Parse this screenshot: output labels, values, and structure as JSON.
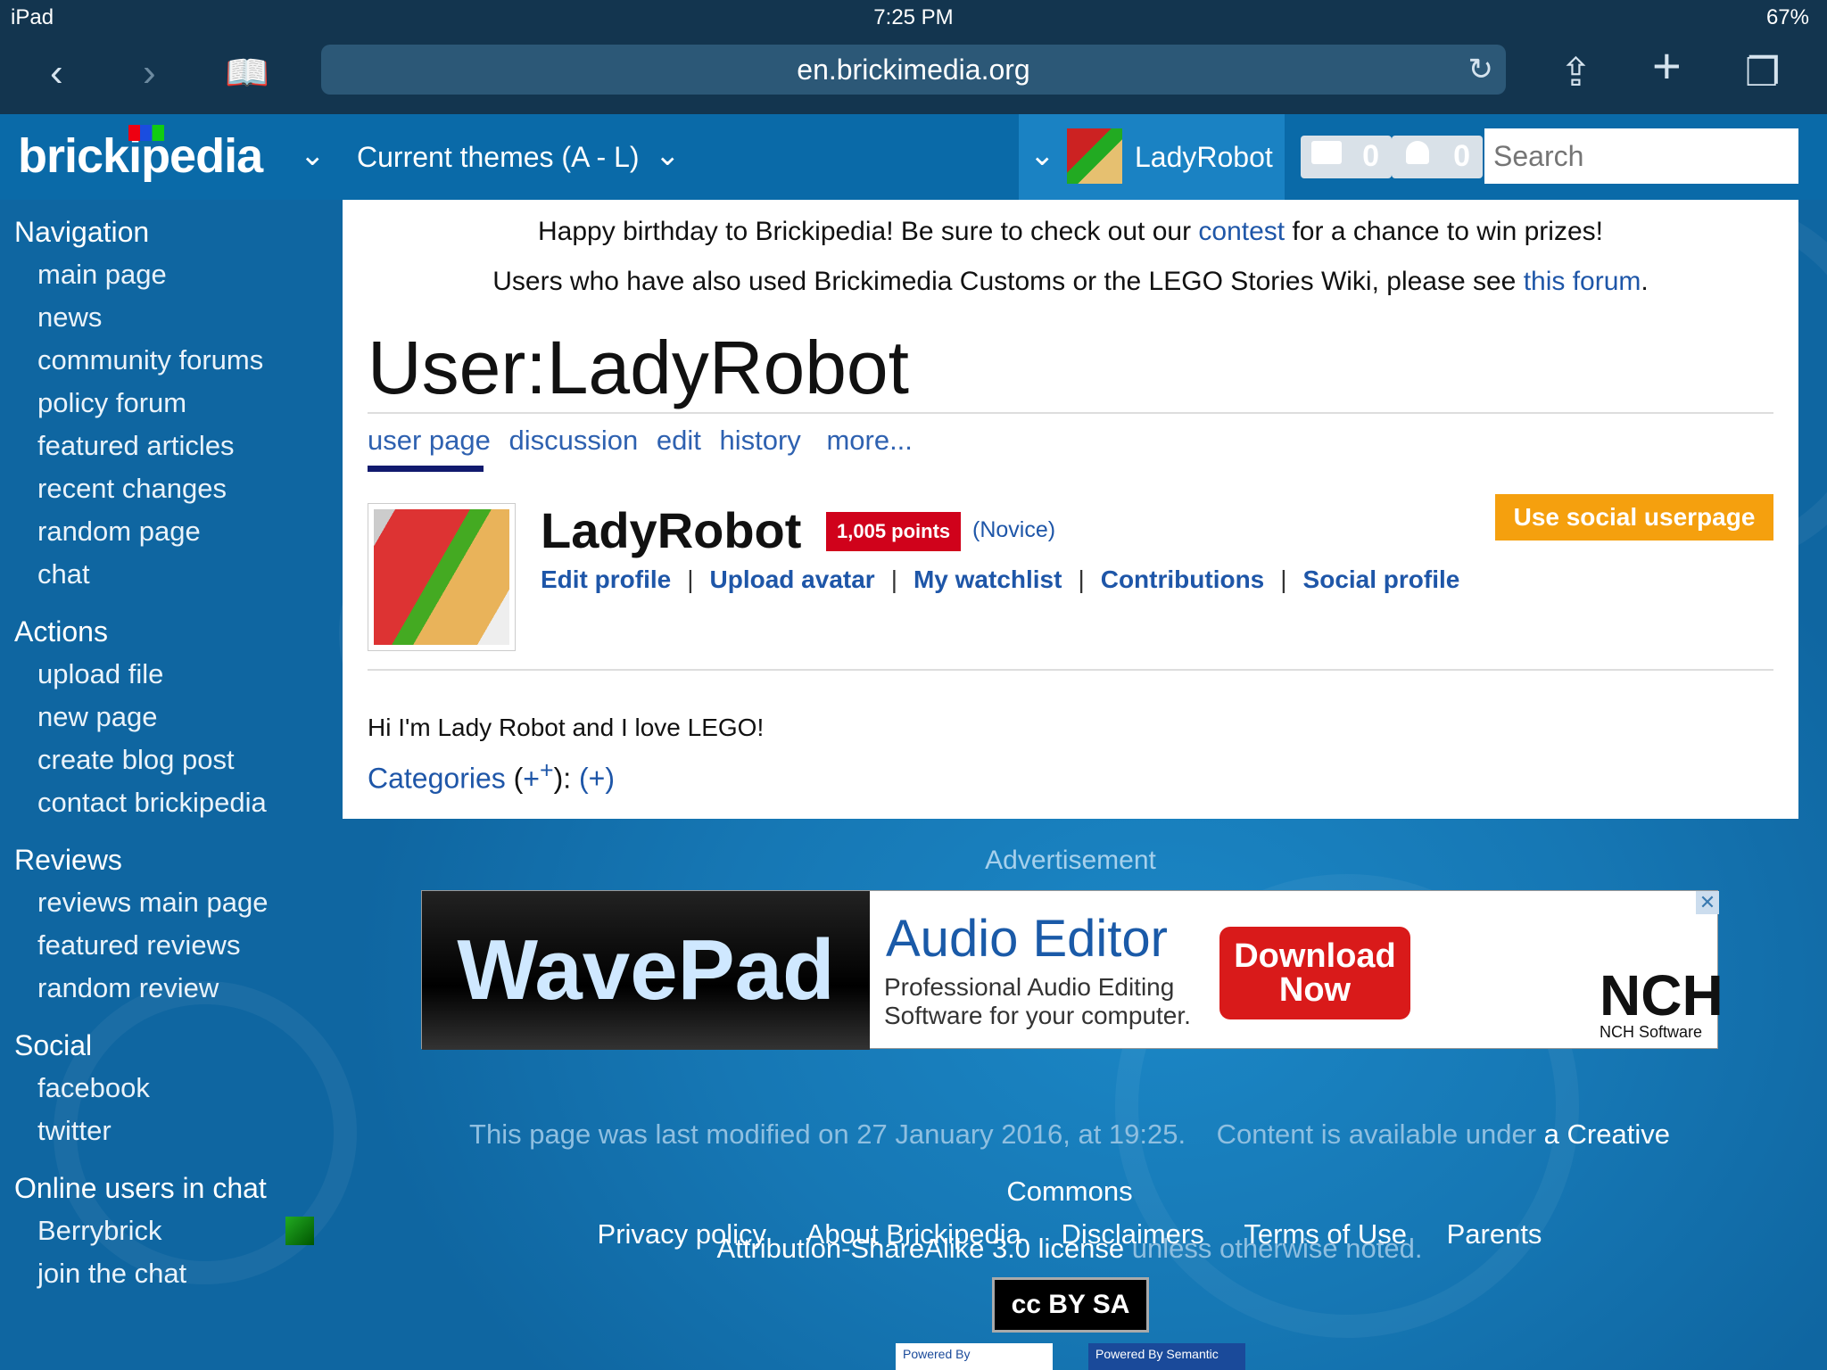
{
  "statusbar": {
    "device": "iPad",
    "time": "7:25 PM",
    "battery": "67%"
  },
  "browser": {
    "url": "en.brickimedia.org"
  },
  "topnav": {
    "logo": "brickipedia",
    "themes": "Current themes (A - L)",
    "username": "LadyRobot",
    "messages_count": "0",
    "notifications_count": "0",
    "search_placeholder": "Search"
  },
  "sidebar": {
    "navigation": {
      "heading": "Navigation",
      "items": [
        "main page",
        "news",
        "community forums",
        "policy forum",
        "featured articles",
        "recent changes",
        "random page",
        "chat"
      ]
    },
    "actions": {
      "heading": "Actions",
      "items": [
        "upload file",
        "new page",
        "create blog post",
        "contact brickipedia"
      ]
    },
    "reviews": {
      "heading": "Reviews",
      "items": [
        "reviews main page",
        "featured reviews",
        "random review"
      ]
    },
    "social": {
      "heading": "Social",
      "items": [
        "facebook",
        "twitter"
      ]
    },
    "online": {
      "heading": "Online users in chat",
      "items": [
        "Berrybrick",
        "join the chat"
      ]
    }
  },
  "notice": {
    "line1_a": "Happy birthday to Brickipedia! Be sure to check out our ",
    "line1_link": "contest",
    "line1_b": " for a chance to win prizes!",
    "line2_a": "Users who have also used Brickimedia Customs or the LEGO Stories Wiki, please see ",
    "line2_link": "this forum",
    "line2_b": "."
  },
  "page": {
    "title": "User:LadyRobot",
    "tabs": [
      "user page",
      "discussion",
      "edit",
      "history",
      "more..."
    ]
  },
  "profile": {
    "name": "LadyRobot",
    "points": "1,005 points",
    "level": "(Novice)",
    "social_button": "Use social userpage",
    "links": [
      "Edit profile",
      "Upload avatar",
      "My watchlist",
      "Contributions",
      "Social profile"
    ],
    "text": "Hi I'm Lady Robot and I love LEGO!",
    "categories_label": "Categories",
    "cat_plus1": "(+",
    "cat_sup": "+",
    "cat_mid": "): ",
    "cat_plus2": "(+)"
  },
  "ad": {
    "label": "Advertisement",
    "brand": "WavePad",
    "headline": "Audio Editor",
    "sub1": "Professional Audio Editing",
    "sub2": "Software for your computer.",
    "button1": "Download",
    "button2": "Now",
    "vendor": "NCH",
    "vendor_full": "NCH Software",
    "close": "✕"
  },
  "footer": {
    "modified": "This page was last modified on 27 January 2016, at 19:25.",
    "content_a": "Content is available under ",
    "content_link1": "a Creative Commons",
    "content_link2": "Attribution-ShareAlike 3.0 license",
    "content_b": " unless otherwise noted.",
    "links": [
      "Privacy policy",
      "About Brickipedia",
      "Disclaimers",
      "Terms of Use",
      "Parents"
    ],
    "cc": "cc BY SA",
    "powered1": "Powered By",
    "powered2": "Powered By Semantic"
  }
}
